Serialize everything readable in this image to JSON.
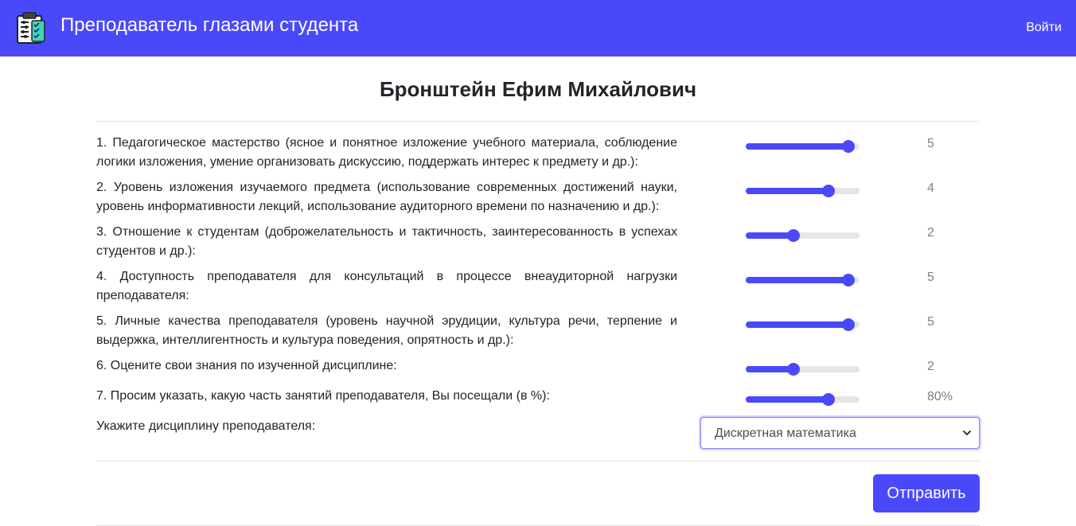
{
  "header": {
    "logo_icon": "teacher-board-icon",
    "brand": "Преподаватель глазами студента",
    "login": "Войти"
  },
  "teacher_name": "Бронштейн Ефим Михайлович",
  "questions": [
    {
      "text": "1. Педагогическое мастерство (ясное и понятное изложение учебного материала, соблюдение логики изложения, умение организовать дискуссию, поддержать интерес к предмету и др.):",
      "value": "5",
      "fraction": 0.9
    },
    {
      "text": "2. Уровень изложения изучаемого предмета (использование современных достижений науки, уровень информативности лекций, использование аудиторного времени по назначению и др.):",
      "value": "4",
      "fraction": 0.73
    },
    {
      "text": "3. Отношение к студентам (доброжелательность и тактичность, заинтересованность в успехах студентов и др.):",
      "value": "2",
      "fraction": 0.42
    },
    {
      "text": "4. Доступность преподавателя для консультаций в процессе внеаудиторной нагрузки преподавателя:",
      "value": "5",
      "fraction": 0.9
    },
    {
      "text": "5. Личные качества преподавателя (уровень научной эрудиции, культура речи, терпение и выдержка, интеллигентность и культура поведения, опрятность и др.):",
      "value": "5",
      "fraction": 0.9
    },
    {
      "text": "6. Оцените свои знания по изученной дисциплине:",
      "value": "2",
      "fraction": 0.42
    },
    {
      "text": "7. Просим указать, какую часть занятий преподавателя, Вы посещали (в %):",
      "value": "80%",
      "fraction": 0.73
    }
  ],
  "discipline": {
    "label": "Укажите дисциплину преподавателя:",
    "selected": "Дискретная математика"
  },
  "submit_label": "Отправить",
  "colors": {
    "accent": "#4a49fa",
    "track": "#e6e6e6"
  }
}
